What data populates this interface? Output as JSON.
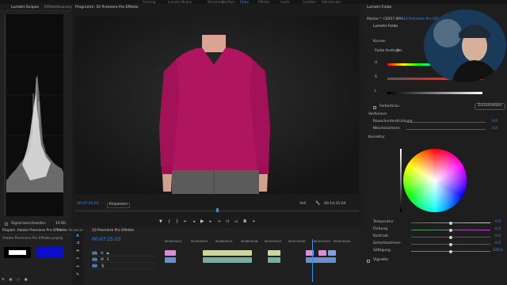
{
  "menu": {
    "items": [
      "Farbring",
      "Lumetri-Modus",
      "Metadaten",
      "Grafiken",
      "Farbe",
      "Effekte",
      "Audio",
      "Grafiken",
      "Bibliotheken"
    ]
  },
  "scopes": {
    "tabs": [
      "Lumetri-Scopes",
      "Effektsteuerungen"
    ],
    "bottom_label": "Signal beschneiden",
    "bit_depth": "10 Bit"
  },
  "program": {
    "title": "Programm: 10 Premiere Pro Effekte",
    "timecode": "00:07:25:03",
    "fit": "Einpassen",
    "quality": "Voll",
    "duration": "00:14:35:04"
  },
  "project": {
    "tabs": [
      "Projekt: Adobe Premiere Pro Effekte",
      "Media-Browser"
    ],
    "filename": "Adobe Premiere Pro Effekte.prproj"
  },
  "timeline": {
    "title": "10 Premiere Pro Effekte",
    "timecode": "00:07:25:03",
    "ruler": [
      "00:05:59:21",
      "00:05:59:22",
      "00:06:59:13",
      "00:06:59:16",
      "00:07:00:13",
      "00:07:09:20",
      "00:07:29:21",
      "00:07:59:12"
    ],
    "clips": [
      "C0006",
      "C0008 [V][99%] [C]",
      "C0006"
    ]
  },
  "lumetri": {
    "tab": "Lumetri-Farbe",
    "source": "Master * C0007.MP4",
    "sequence": "10 Premiere Pro Effekte",
    "header": "Lumetri-Farbe",
    "sections": {
      "curves": "Kurven",
      "saturation": "Farbe/Sättigung",
      "vignette": "Vignette",
      "color_wheel": "Korrektur"
    },
    "hsl_label": "Farbe festlegen",
    "channels": [
      "H",
      "S",
      "L"
    ],
    "colorgrade_label": "Farbe/Grau",
    "reset": "Zurücksetzen",
    "denoise_label": "Verfeinern",
    "denoise_rows": [
      {
        "label": "Rauschunterdrückung",
        "value": "0,0"
      },
      {
        "label": "Weichzeichnen",
        "value": "0,0"
      }
    ],
    "wheel_controls": [
      {
        "label": "Temperatur",
        "value": "0,0",
        "fill": 0.5
      },
      {
        "label": "Färbung",
        "value": "0,0",
        "fill": 0.5
      },
      {
        "label": "Kontrast",
        "value": "0,0",
        "fill": 0.5
      },
      {
        "label": "Scharfzeichnen",
        "value": "0,0",
        "fill": 0.5
      },
      {
        "label": "Sättigung",
        "value": "100,0",
        "fill": 0.5
      }
    ],
    "footer": "Vignette"
  },
  "colors": {
    "accent": "#2f8ef2",
    "sweater": "#b0155f",
    "bg": "#1d1d1d"
  }
}
